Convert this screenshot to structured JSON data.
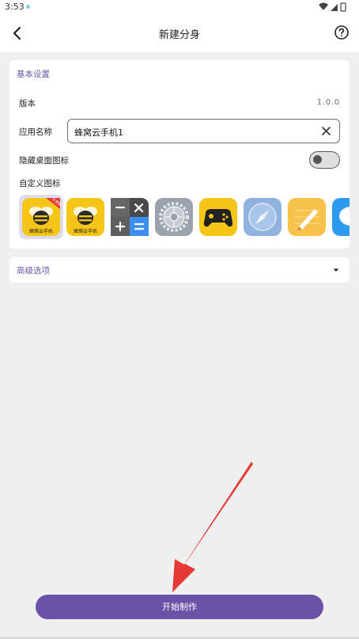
{
  "status_bar": {
    "time": "3:53",
    "icons": [
      "wifi-icon",
      "signal-icon",
      "battery-icon"
    ]
  },
  "header": {
    "title": "新建分身",
    "back_icon": "back-arrow-icon",
    "help_icon": "help-icon"
  },
  "basic_settings": {
    "section_title": "基本设置",
    "version_label": "版本",
    "version_value": "1.0.0",
    "app_name_label": "应用名称",
    "app_name_value": "蜂窝云手机1",
    "hide_icon_label": "隐藏桌面图标",
    "hide_icon_enabled": false,
    "custom_icon_label": "自定义图标",
    "custom_icons": [
      {
        "name": "bee-app-icon-badged",
        "selected": true
      },
      {
        "name": "bee-app-icon",
        "selected": false
      },
      {
        "name": "calculator-icon",
        "selected": false
      },
      {
        "name": "settings-gear-icon",
        "selected": false
      },
      {
        "name": "gamepad-icon",
        "selected": false
      },
      {
        "name": "compass-icon",
        "selected": false
      },
      {
        "name": "notes-icon",
        "selected": false
      },
      {
        "name": "message-icon",
        "selected": false
      }
    ]
  },
  "advanced": {
    "label": "高级选项",
    "icon": "chevron-down-icon"
  },
  "footer": {
    "start_button_label": "开始制作"
  },
  "icon_text": {
    "bee_caption": "蜂窝云手机",
    "badge": "分身版"
  },
  "colors": {
    "accent": "#6a52a6",
    "section_title": "#6b5aa6",
    "background": "#efefef",
    "arrow": "#e53935"
  }
}
